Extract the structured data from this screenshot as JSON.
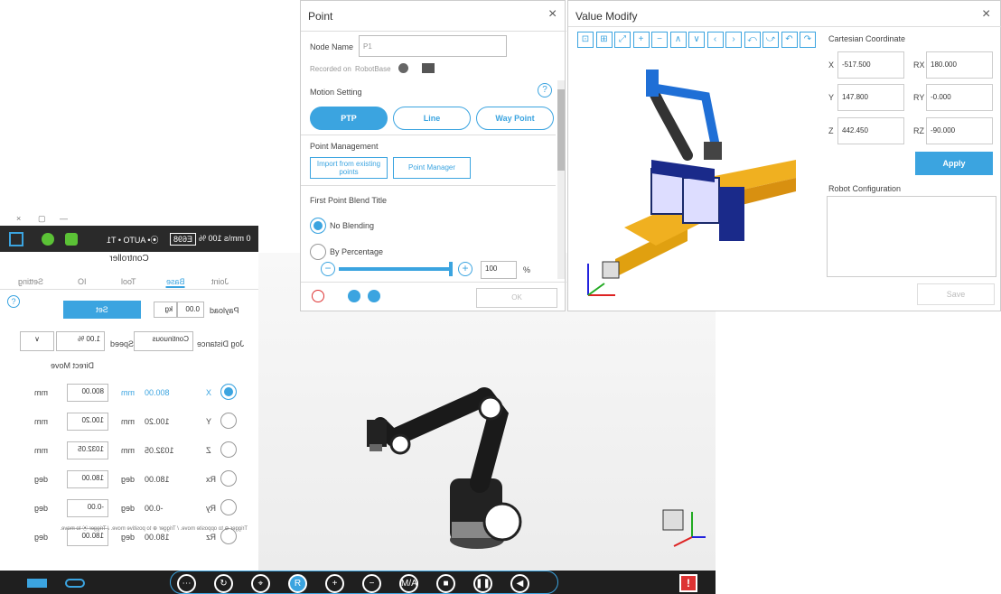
{
  "controller": {
    "window_controls": [
      "×",
      "▢",
      "—"
    ],
    "status_speed": "0 mm\\s 100 %",
    "status_code": "E698",
    "status_mode": "⦿• AUTO • T1",
    "title": "Controller",
    "tabs": [
      "Joint",
      "Base",
      "Tool",
      "IO",
      "Setting"
    ],
    "payload_label": "Payload",
    "payload_value": "0.00",
    "payload_unit": "kg",
    "set_label": "Set",
    "jog_label": "Jog Distance",
    "jog_value": "Continuous",
    "speed_label": "Speed",
    "speed_value": "1.00 %",
    "direct_move": "Direct Move",
    "rows": [
      {
        "axis": "X",
        "value": "800.00",
        "unit": "mm",
        "target": "800.00",
        "tunit": "mm"
      },
      {
        "axis": "Y",
        "value": "100.20",
        "unit": "mm",
        "target": "100.20",
        "tunit": "mm"
      },
      {
        "axis": "Z",
        "value": "1032.05",
        "unit": "mm",
        "target": "1032.05",
        "tunit": "mm"
      },
      {
        "axis": "Rx",
        "value": "180.00",
        "unit": "deg",
        "target": "180.00",
        "tunit": "deg"
      },
      {
        "axis": "Ry",
        "value": "-0.00",
        "unit": "deg",
        "target": "-0.00",
        "tunit": "deg"
      },
      {
        "axis": "Rz",
        "value": "180.00",
        "unit": "deg",
        "target": "180.00",
        "tunit": "deg"
      }
    ],
    "trigger_note": "Trigger ⊖ to opposite move. / Trigger ⊕ to positive move. / Trigger ⦿ to move."
  },
  "bottom_toolbar": {
    "buttons": [
      "⋯",
      "↻",
      "⌖",
      "R",
      "+",
      "−",
      "M/A",
      "■",
      "❚❚",
      "◀"
    ]
  },
  "point": {
    "title": "Point",
    "node_name_label": "Node Name",
    "node_name_value": "P1",
    "recorded_label": "Recorded on",
    "recorded_value": "RobotBase",
    "motion_setting": "Motion Setting",
    "motion_buttons": [
      "PTP",
      "Line",
      "Way Point"
    ],
    "point_management": "Point Management",
    "import_label": "Import from existing points",
    "manager_label": "Point Manager",
    "blend_title": "First Point Blend Title",
    "no_blending": "No Blending",
    "by_percentage": "By Percentage",
    "percentage_value": "100",
    "percentage_unit": "%",
    "percentage_fraction": 1.0,
    "ok_label": "OK"
  },
  "value_modify": {
    "title": "Value Modify",
    "toolbar_icons": [
      "⊡",
      "⊞",
      "⤢",
      "+",
      "−",
      "∧",
      "∨",
      "‹",
      "›",
      "⤺",
      "⤻",
      "↶",
      "↷"
    ],
    "cartesian_title": "Cartesian Coordinate",
    "x_label": "X",
    "x_value": "-517.500",
    "y_label": "Y",
    "y_value": "147.800",
    "z_label": "Z",
    "z_value": "442.450",
    "rx_label": "RX",
    "rx_value": "180.000",
    "ry_label": "RY",
    "ry_value": "-0.000",
    "rz_label": "RZ",
    "rz_value": "-90.000",
    "apply_label": "Apply",
    "robot_config_title": "Robot Configuration",
    "save_label": "Save"
  },
  "colors": {
    "accent": "#3ba4e0",
    "robot_blue": "#1f6fd6",
    "pallet": "#e0a010",
    "dark": "#1f1f1f"
  }
}
